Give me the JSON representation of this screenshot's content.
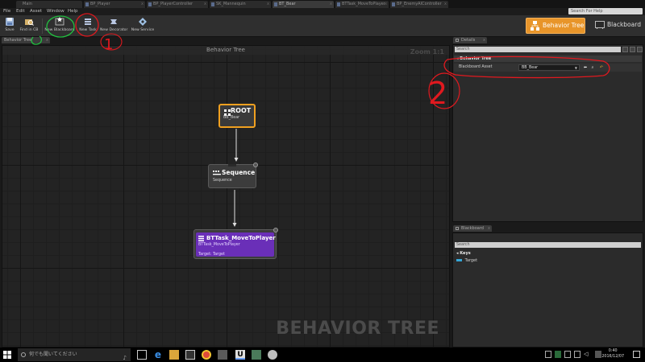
{
  "tabs": [
    {
      "label": "Main"
    },
    {
      "label": "BP_Player"
    },
    {
      "label": "BP_PlayerController"
    },
    {
      "label": "SK_Mannequin"
    },
    {
      "label": "BT_Bear"
    },
    {
      "label": "BTTask_MoveToPlayer"
    },
    {
      "label": "BP_EnemyAIController"
    }
  ],
  "menu": [
    "File",
    "Edit",
    "Asset",
    "Window",
    "Help"
  ],
  "search_help": {
    "placeholder": "Search For Help"
  },
  "toolbar": {
    "save": "Save",
    "find_in_cb": "Find in CB",
    "new_blackboard": "New Blackboard",
    "new_task": "New Task",
    "new_decorator": "New Decorator",
    "new_service": "New Service"
  },
  "modes": {
    "behavior_tree": "Behavior Tree",
    "blackboard": "Blackboard"
  },
  "graph": {
    "tab_label": "Behavior Tree",
    "title": "Behavior Tree",
    "zoom": "Zoom 1:1",
    "watermark": "BEHAVIOR TREE",
    "nodes": {
      "root": {
        "title": "ROOT",
        "subtitle": "BB_Bear"
      },
      "sequence": {
        "title": "Sequence",
        "subtitle": "Sequence"
      },
      "task": {
        "title": "BTTask_MoveToPlayer",
        "subtitle": "BTTask_MoveToPlayer",
        "param": "Target: Target"
      }
    }
  },
  "details": {
    "tab_label": "Details",
    "search_placeholder": "Search",
    "category": "Behavior Tree",
    "property_label": "Blackboard Asset",
    "property_value": "BB_Bear"
  },
  "blackboard_panel": {
    "tab_label": "Blackboard",
    "search_placeholder": "Search",
    "category": "Keys",
    "keys": [
      "Target"
    ]
  },
  "annotations": {
    "label_1": "1",
    "label_2": "2"
  },
  "taskbar": {
    "search_placeholder": "何でも聞いてください",
    "time": "0:40",
    "date": "2016/12/07"
  },
  "colors": {
    "root_border": "#f0a020",
    "task_fill": "#6a2fb8",
    "behavior_tree_mode": "#e8952a",
    "annotation_red": "#e0191f",
    "annotation_green": "#22c040"
  }
}
